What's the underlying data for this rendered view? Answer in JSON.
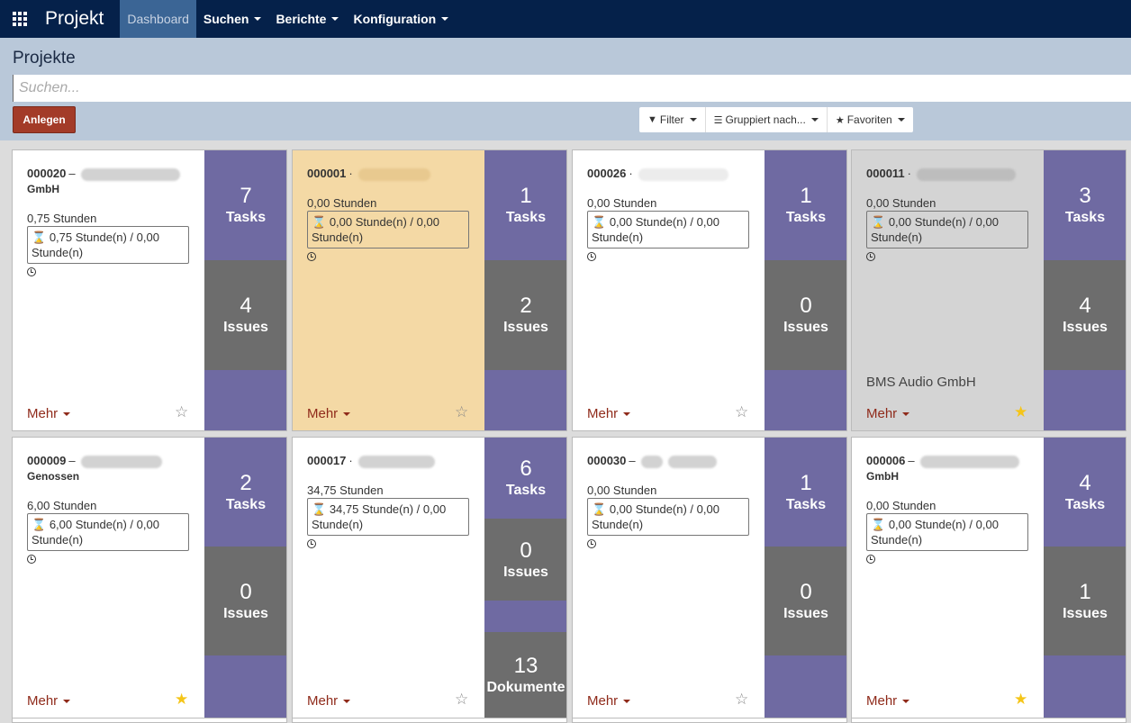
{
  "app": {
    "title": "Projekt"
  },
  "nav": {
    "items": [
      {
        "label": "Dashboard",
        "active": true
      },
      {
        "label": "Suchen"
      },
      {
        "label": "Berichte"
      },
      {
        "label": "Konfiguration"
      }
    ]
  },
  "page": {
    "title": "Projekte"
  },
  "search": {
    "placeholder": "Suchen..."
  },
  "actions": {
    "create": "Anlegen"
  },
  "search_options": {
    "filter": "Filter",
    "group_by": "Gruppiert nach...",
    "favorites": "Favoriten"
  },
  "colors": {
    "navbar": "#05214a",
    "control_panel": "#b9c8d9",
    "accent_red": "#a33b28",
    "stat_purple": "#6f6aa2",
    "stat_gray": "#6d6d6d",
    "star_on": "#f5c518"
  },
  "cards": [
    {
      "code": "000020",
      "sep": "–",
      "subname": "GmbH",
      "hours": "0,75 Stunden",
      "box1": "0,75 Stunde(n) / 0,00",
      "box2": "Stunde(n)",
      "customer": "",
      "tasks": "7",
      "tasks_label": "Tasks",
      "issues": "4",
      "issues_label": "Issues",
      "mehr": "Mehr",
      "starred": false
    },
    {
      "code": "000001",
      "sep": "·",
      "subname": "",
      "hours": "0,00 Stunden",
      "box1": "0,00 Stunde(n) / 0,00",
      "box2": "Stunde(n)",
      "customer": "",
      "tasks": "1",
      "tasks_label": "Tasks",
      "issues": "2",
      "issues_label": "Issues",
      "mehr": "Mehr",
      "starred": false
    },
    {
      "code": "000026",
      "sep": "·",
      "subname": "",
      "hours": "0,00 Stunden",
      "box1": "0,00 Stunde(n) / 0,00",
      "box2": "Stunde(n)",
      "customer": "",
      "tasks": "1",
      "tasks_label": "Tasks",
      "issues": "0",
      "issues_label": "Issues",
      "mehr": "Mehr",
      "starred": false
    },
    {
      "code": "000011",
      "sep": "·",
      "subname": "",
      "hours": "0,00 Stunden",
      "box1": "0,00 Stunde(n) / 0,00",
      "box2": "Stunde(n)",
      "customer": "BMS Audio GmbH",
      "tasks": "3",
      "tasks_label": "Tasks",
      "issues": "4",
      "issues_label": "Issues",
      "mehr": "Mehr",
      "starred": true
    },
    {
      "code": "000009",
      "sep": "–",
      "subname": "Genossen",
      "hours": "6,00 Stunden",
      "box1": "6,00 Stunde(n) / 0,00",
      "box2": "Stunde(n)",
      "customer": "",
      "tasks": "2",
      "tasks_label": "Tasks",
      "issues": "0",
      "issues_label": "Issues",
      "mehr": "Mehr",
      "starred": true
    },
    {
      "code": "000017",
      "sep": "·",
      "subname": "",
      "hours": "34,75 Stunden",
      "box1": "34,75 Stunde(n) / 0,00",
      "box2": "Stunde(n)",
      "customer": "",
      "tasks": "6",
      "tasks_label": "Tasks",
      "issues": "0",
      "issues_label": "Issues",
      "docs": "13",
      "docs_label": "Dokumente",
      "mehr": "Mehr",
      "starred": false
    },
    {
      "code": "000030",
      "sep": "–",
      "subname": "",
      "hours": "0,00 Stunden",
      "box1": "0,00 Stunde(n) / 0,00",
      "box2": "Stunde(n)",
      "customer": "",
      "tasks": "1",
      "tasks_label": "Tasks",
      "issues": "0",
      "issues_label": "Issues",
      "mehr": "Mehr",
      "starred": false
    },
    {
      "code": "000006",
      "sep": "–",
      "subname": "GmbH",
      "hours": "0,00 Stunden",
      "box1": "0,00 Stunde(n) / 0,00",
      "box2": "Stunde(n)",
      "customer": "",
      "tasks": "4",
      "tasks_label": "Tasks",
      "issues": "1",
      "issues_label": "Issues",
      "mehr": "Mehr",
      "starred": true
    }
  ]
}
